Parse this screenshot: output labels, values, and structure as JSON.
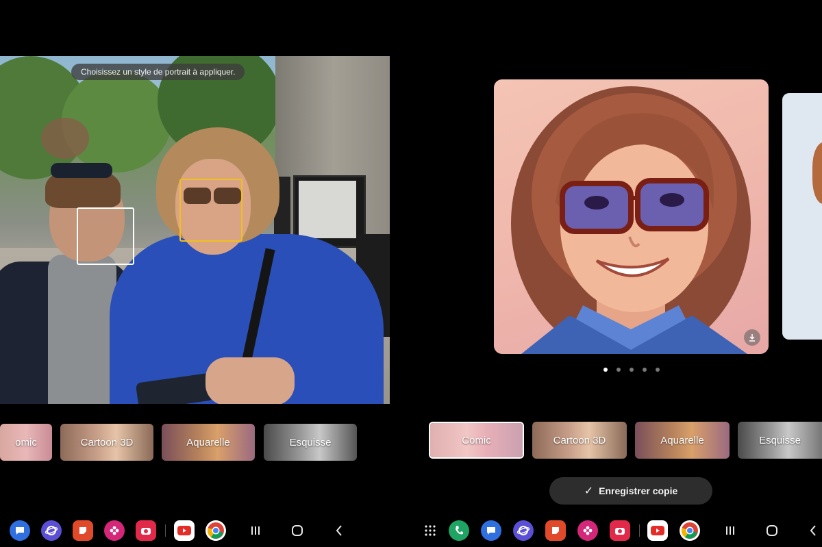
{
  "left_panel": {
    "hint": "Choisissez un style de portrait à appliquer.",
    "styles": [
      {
        "label": "omic"
      },
      {
        "label": "Cartoon 3D"
      },
      {
        "label": "Aquarelle"
      },
      {
        "label": "Esquisse"
      }
    ]
  },
  "right_panel": {
    "styles": [
      {
        "label": "Comic",
        "selected": true
      },
      {
        "label": "Cartoon 3D"
      },
      {
        "label": "Aquarelle"
      },
      {
        "label": "Esquisse"
      }
    ],
    "page_dots": {
      "count": 5,
      "active": 1
    },
    "save_button": {
      "icon": "check-icon",
      "label": "Enregistrer copie"
    },
    "download_icon": "download-icon"
  },
  "taskbar_left": {
    "apps": [
      "messages-icon",
      "internet-icon",
      "notes-icon",
      "gallery-flower-icon",
      "camera-icon",
      "youtube-icon",
      "chrome-icon"
    ],
    "nav": [
      "recents-icon",
      "home-icon",
      "back-icon"
    ]
  },
  "taskbar_right": {
    "apps": [
      "app-drawer-icon",
      "phone-icon",
      "messages-icon",
      "internet-icon",
      "notes-icon",
      "gallery-flower-icon",
      "camera-icon",
      "youtube-icon",
      "chrome-icon"
    ],
    "nav": [
      "recents-icon",
      "home-icon",
      "back-icon"
    ]
  },
  "colors": {
    "selection_face": "#f0c020",
    "youtube": "#e52d27",
    "phone": "#1fa463",
    "messages": "#2f6fe0"
  }
}
